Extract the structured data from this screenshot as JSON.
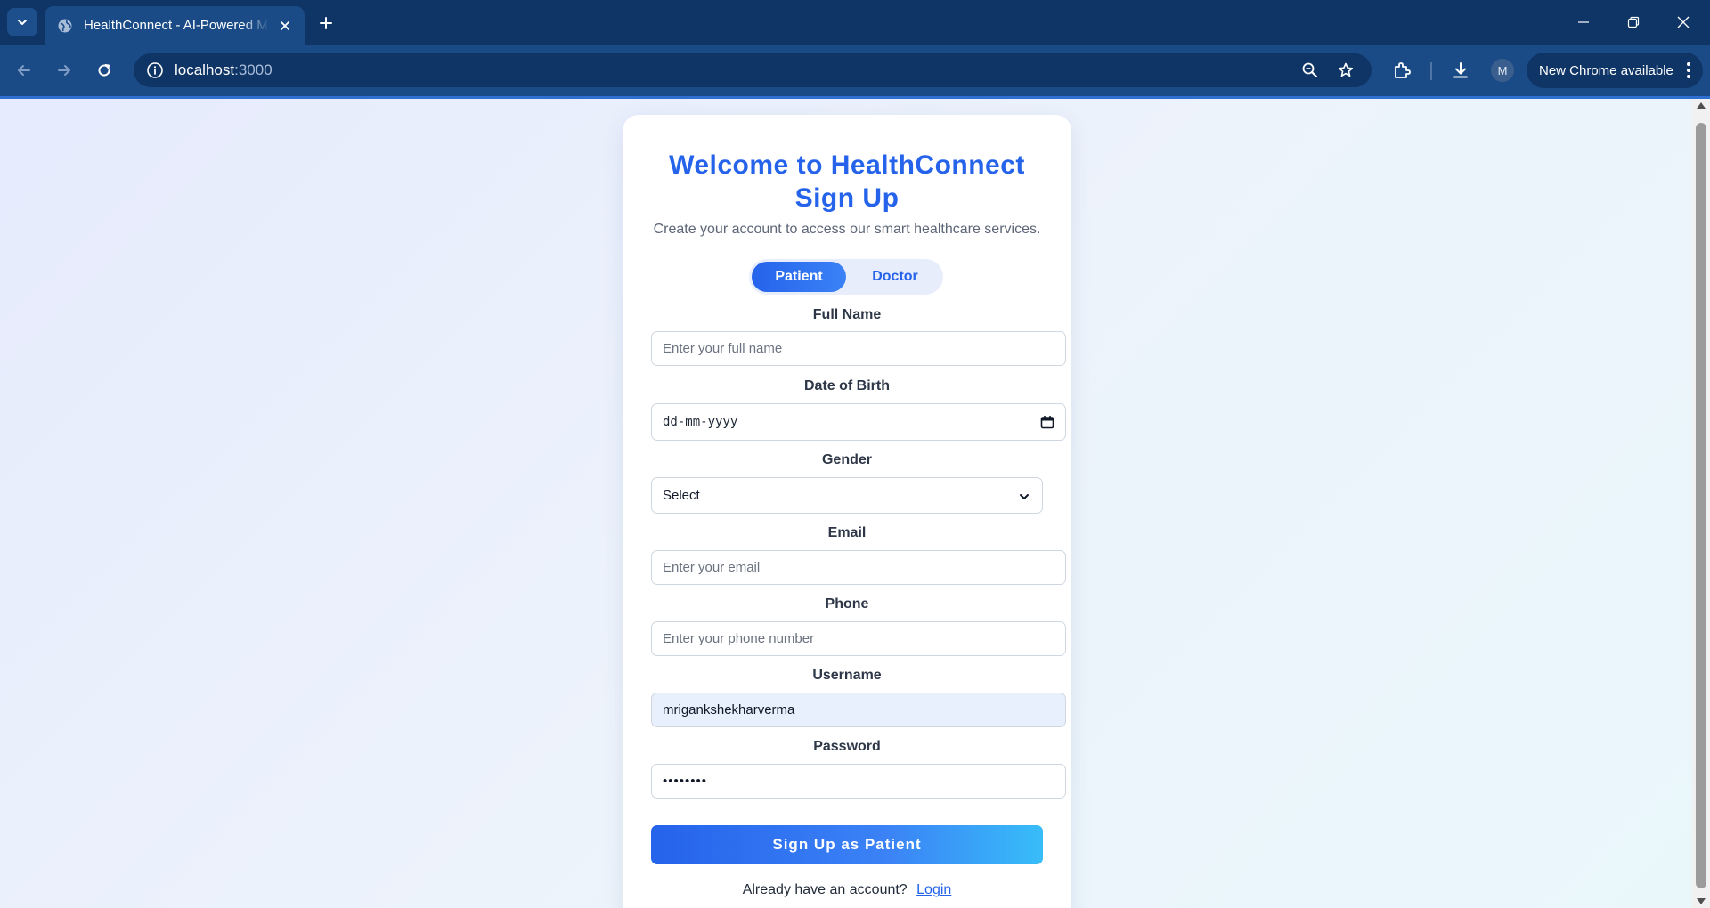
{
  "browser": {
    "tab_title": "HealthConnect - AI-Powered Medical",
    "url_host": "localhost",
    "url_port": ":3000",
    "profile_initial": "M",
    "update_label": "New Chrome available"
  },
  "page": {
    "heading_line1": "Welcome to HealthConnect",
    "heading_line2": "Sign Up",
    "subtitle": "Create your account to access our smart healthcare services.",
    "roles": [
      "Patient",
      "Doctor"
    ],
    "active_role": "Patient",
    "fields": {
      "full_name": {
        "label": "Full Name",
        "placeholder": "Enter your full name"
      },
      "dob": {
        "label": "Date of Birth",
        "placeholder": "dd-mm-yyyy"
      },
      "gender": {
        "label": "Gender",
        "value": "Select"
      },
      "email": {
        "label": "Email",
        "placeholder": "Enter your email"
      },
      "phone": {
        "label": "Phone",
        "placeholder": "Enter your phone number"
      },
      "username": {
        "label": "Username",
        "value": "mrigankshekharverma"
      },
      "password": {
        "label": "Password",
        "value": "••••••••"
      }
    },
    "submit_label": "Sign Up as Patient",
    "login_prompt": "Already have an account?",
    "login_link": "Login"
  },
  "colors": {
    "accent": "#2563eb",
    "chrome_dark": "#0f3566",
    "chrome_toolbar": "#1a4b87"
  }
}
